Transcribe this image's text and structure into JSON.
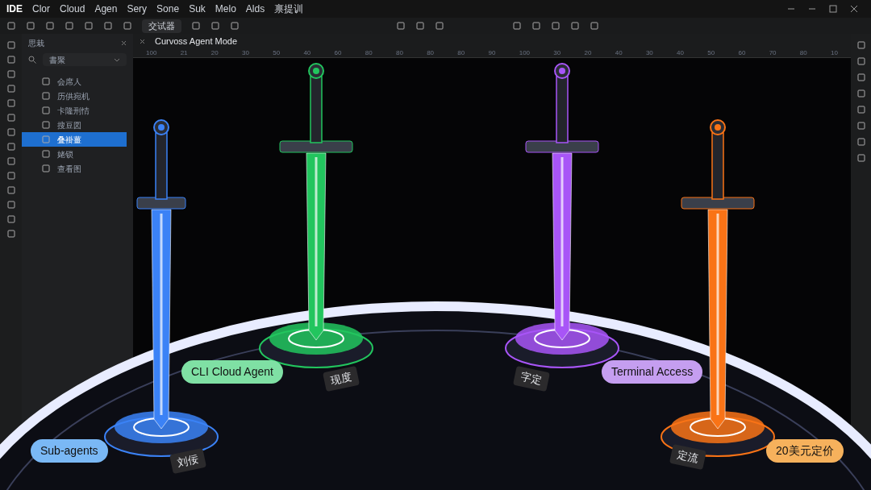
{
  "menu": [
    "IDE",
    "Clor",
    "Cloud",
    "Agen",
    "Sery",
    "Sone",
    "Suk",
    "Melo",
    "Alds",
    "禀提训"
  ],
  "toolbar": {
    "button": "交试器"
  },
  "panel": {
    "title": "思栽",
    "search": "書聚",
    "items": [
      {
        "label": "会席人",
        "selected": false
      },
      {
        "label": "历供宛机",
        "selected": false
      },
      {
        "label": "卡隆刑情",
        "selected": false
      },
      {
        "label": "搜豆図",
        "selected": false
      },
      {
        "label": "叠褂薑",
        "selected": true
      },
      {
        "label": "姥锁",
        "selected": false
      },
      {
        "label": "查看图",
        "selected": false
      }
    ]
  },
  "editor": {
    "tab": "Curvoss Agent Mode",
    "ruler": [
      "100",
      "21",
      "20",
      "30",
      "50",
      "40",
      "60",
      "80",
      "80",
      "80",
      "80",
      "90",
      "100",
      "30",
      "20",
      "40",
      "30",
      "40",
      "50",
      "60",
      "70",
      "80",
      "10"
    ]
  },
  "swords": [
    {
      "color": "#3b82f6",
      "plaque": "刘佞",
      "label": "Sub-agents"
    },
    {
      "color": "#22c55e",
      "plaque": "现度",
      "label": "CLI Cloud Agent"
    },
    {
      "color": "#a855f7",
      "plaque": "字定",
      "label": "Terminal Access"
    },
    {
      "color": "#f97316",
      "plaque": "定流",
      "label": "20美元定价"
    }
  ]
}
